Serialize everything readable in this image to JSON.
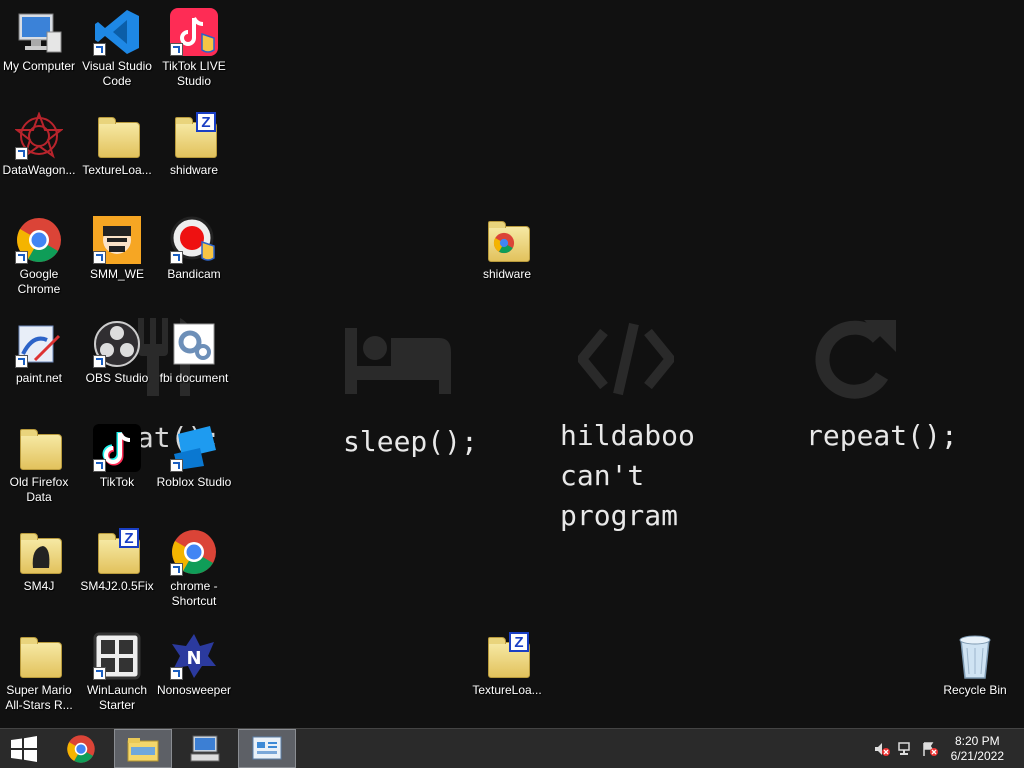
{
  "wallpaper": {
    "eat_text": "eat();",
    "sleep_text": "sleep();",
    "code_text": "hildaboo\ncan't\nprogram",
    "repeat_text": "repeat();"
  },
  "desktop_icons": {
    "my_computer": "My Computer",
    "vscode": "Visual Studio Code",
    "tiktok_live": "TikTok LIVE Studio",
    "datawagon": "DataWagon...",
    "textureloa1": "TextureLoa...",
    "shidware1": "shidware",
    "chrome": "Google Chrome",
    "smm_we": "SMM_WE",
    "bandicam": "Bandicam",
    "shidware2": "shidware",
    "paintnet": "paint.net",
    "obs": "OBS Studio",
    "fbi": "fbi document",
    "old_firefox": "Old Firefox Data",
    "tiktok": "TikTok",
    "roblox": "Roblox Studio",
    "sm4j": "SM4J",
    "sm4j2": "SM4J2.0.5Fix",
    "chrome_shortcut": "chrome - Shortcut",
    "smas": "Super Mario All-Stars R...",
    "winlaunch": "WinLaunch Starter",
    "nonosweeper": "Nonosweeper",
    "textureloa2": "TextureLoa...",
    "recycle_bin": "Recycle Bin"
  },
  "taskbar": {
    "time": "8:20 PM",
    "date": "6/21/2022",
    "items": [
      "start-icon",
      "chrome-icon",
      "file-explorer-icon",
      "remote-desktop-icon",
      "control-panel-icon"
    ]
  },
  "colors": {
    "taskbar": "#2a2a2a",
    "active": "#5d6066",
    "desktop": "#111111"
  }
}
